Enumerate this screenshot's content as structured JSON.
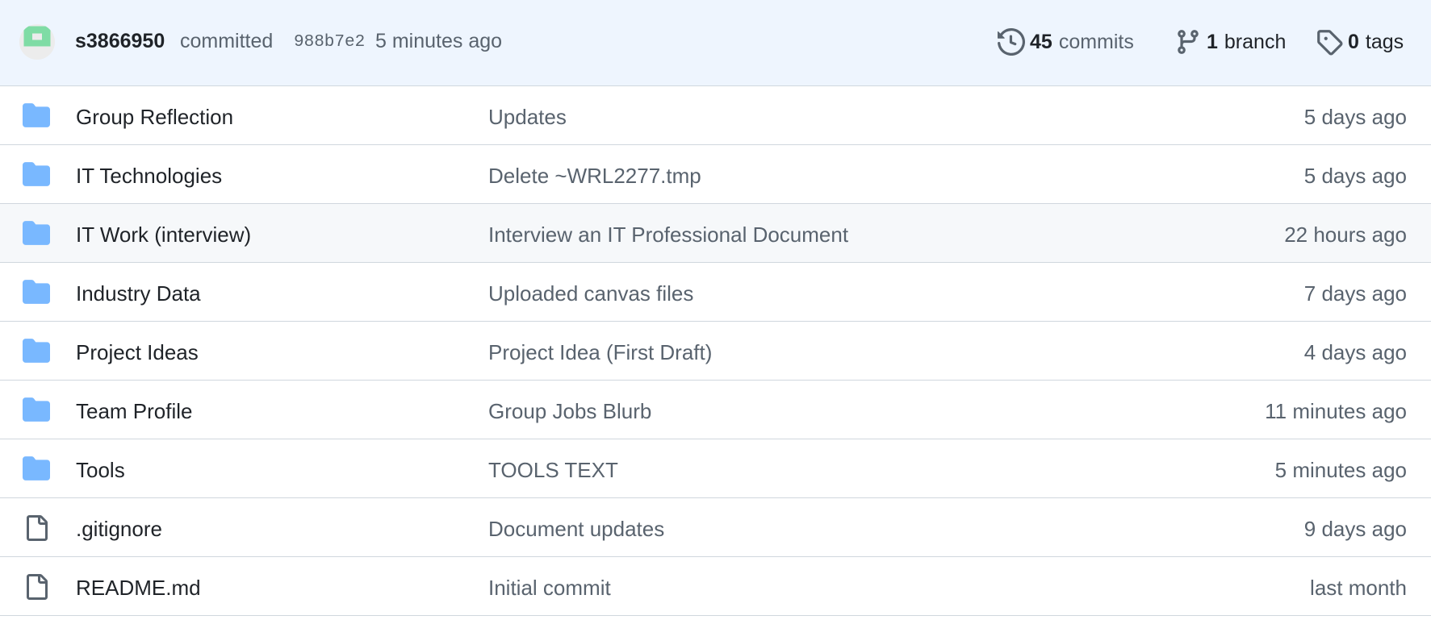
{
  "commit_bar": {
    "author": "s3866950",
    "action": "committed",
    "sha": "988b7e2",
    "time": "5 minutes ago",
    "commits_count": "45",
    "commits_label": "commits",
    "branch_count": "1",
    "branch_label": "branch",
    "tags_count": "0",
    "tags_label": "tags"
  },
  "colors": {
    "folder": "#79b8ff",
    "file": "#59636e",
    "header_bg": "#eef5fe",
    "avatar_green": "#7fdca5"
  },
  "files": [
    {
      "name": "Group Reflection",
      "type": "folder",
      "icon": "folder-icon",
      "message": "Updates",
      "age": "5 days ago"
    },
    {
      "name": "IT Technologies",
      "type": "folder",
      "icon": "folder-icon",
      "message": "Delete ~WRL2277.tmp",
      "age": "5 days ago"
    },
    {
      "name": "IT Work (interview)",
      "type": "folder",
      "icon": "folder-icon",
      "message": "Interview an IT Professional Document",
      "age": "22 hours ago"
    },
    {
      "name": "Industry Data",
      "type": "folder",
      "icon": "folder-icon",
      "message": "Uploaded canvas files",
      "age": "7 days ago"
    },
    {
      "name": "Project Ideas",
      "type": "folder",
      "icon": "folder-icon",
      "message": "Project Idea (First Draft)",
      "age": "4 days ago"
    },
    {
      "name": "Team Profile",
      "type": "folder",
      "icon": "folder-icon",
      "message": "Group Jobs Blurb",
      "age": "11 minutes ago"
    },
    {
      "name": "Tools",
      "type": "folder",
      "icon": "folder-icon",
      "message": "TOOLS TEXT",
      "age": "5 minutes ago"
    },
    {
      "name": ".gitignore",
      "type": "file",
      "icon": "file-icon",
      "message": "Document updates",
      "age": "9 days ago"
    },
    {
      "name": "README.md",
      "type": "file",
      "icon": "file-icon",
      "message": "Initial commit",
      "age": "last month"
    }
  ]
}
